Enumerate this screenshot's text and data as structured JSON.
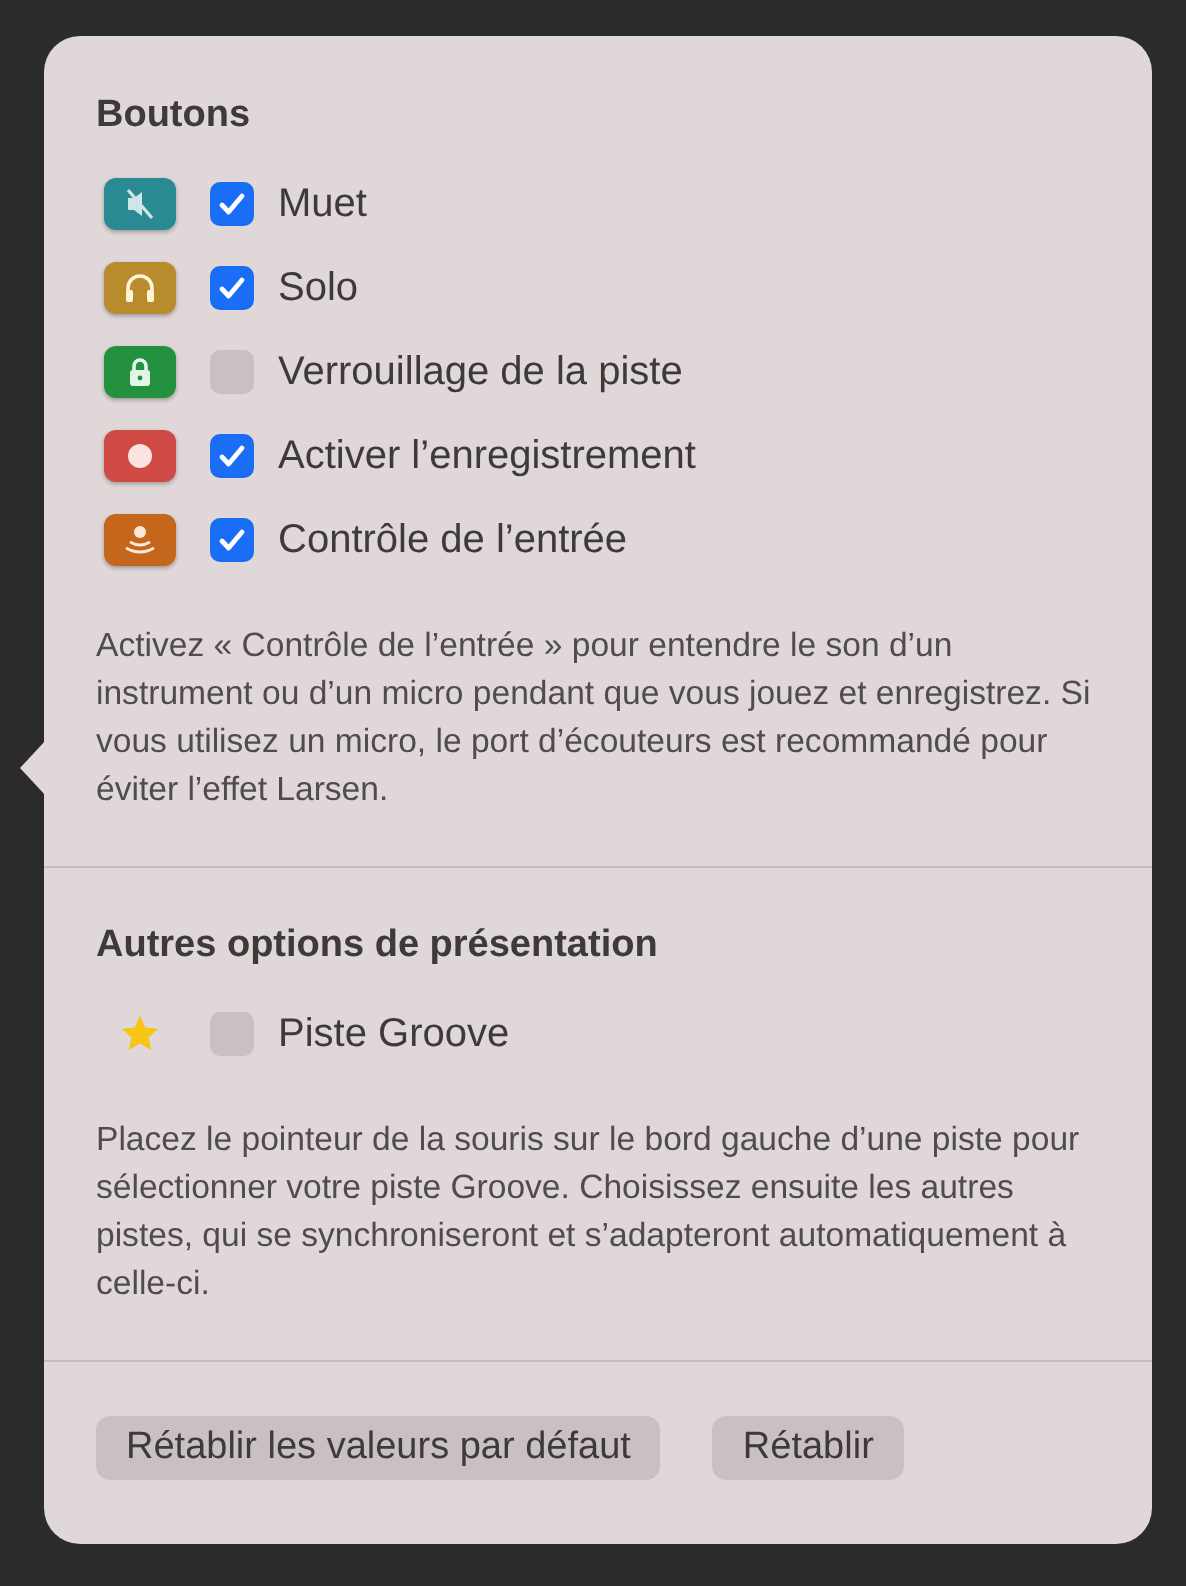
{
  "sections": [
    {
      "title": "Boutons",
      "options": [
        {
          "kind": "mute",
          "color": "#2a8a94",
          "label": "Muet",
          "checked": true
        },
        {
          "kind": "solo",
          "color": "#b88c2c",
          "label": "Solo",
          "checked": true
        },
        {
          "kind": "lock",
          "color": "#24913e",
          "label": "Verrouillage de la piste",
          "checked": false
        },
        {
          "kind": "record",
          "color": "#cf4a45",
          "label": "Activer l’enregistrement",
          "checked": true
        },
        {
          "kind": "monitor",
          "color": "#c4661c",
          "label": "Contrôle de l’entrée",
          "checked": true
        }
      ],
      "description": "Activez « Contrôle de l’entrée » pour entendre le son d’un instrument ou d’un micro pendant que vous jouez et enregistrez. Si vous utilisez un micro, le port d’écouteurs est recommandé pour éviter l’effet Larsen."
    },
    {
      "title": "Autres options de présentation",
      "options": [
        {
          "kind": "groove",
          "label": "Piste Groove",
          "checked": false
        }
      ],
      "description": "Placez le pointeur de la souris sur le bord gauche d’une piste pour sélectionner votre piste Groove. Choisissez ensuite les autres pistes, qui se synchroniseront et s’adapteront automatiquement à celle-ci."
    }
  ],
  "buttons": [
    "Rétablir les valeurs par défaut",
    "Rétablir"
  ]
}
